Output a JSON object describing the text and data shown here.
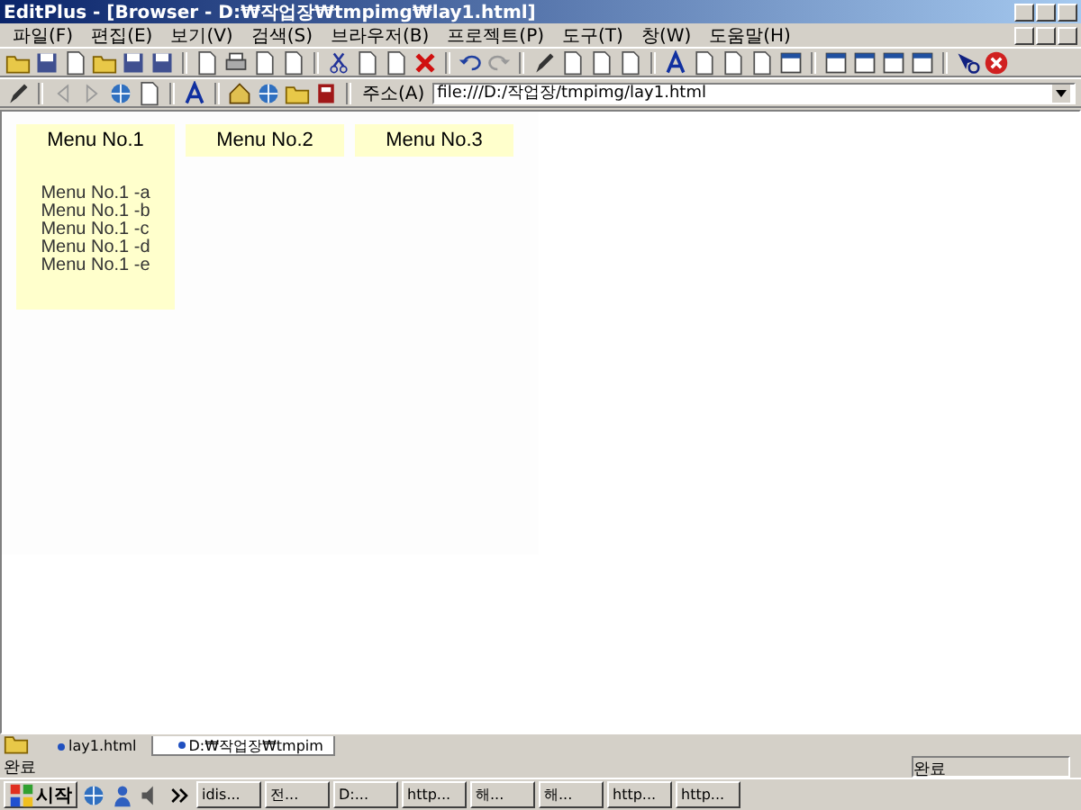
{
  "window": {
    "title": "EditPlus - [Browser - D:₩작업장₩tmpimg₩lay1.html]"
  },
  "menu_bar": [
    "파일(F)",
    "편집(E)",
    "보기(V)",
    "검색(S)",
    "브라우저(B)",
    "프로젝트(P)",
    "도구(T)",
    "창(W)",
    "도움말(H)"
  ],
  "address_bar": {
    "label": "주소(A)",
    "value": "file:///D:/작업장/tmpimg/lay1.html"
  },
  "page": {
    "menus": [
      {
        "title": "Menu No.1",
        "expanded": true,
        "items": [
          "Menu No.1 -a",
          "Menu No.1 -b",
          "Menu No.1 -c",
          "Menu No.1 -d",
          "Menu No.1 -e"
        ]
      },
      {
        "title": "Menu No.2",
        "expanded": false
      },
      {
        "title": "Menu No.3",
        "expanded": false
      }
    ]
  },
  "document_tabs": [
    {
      "label": "lay1.html",
      "selected": false
    },
    {
      "label": "D:₩작업장₩tmpim",
      "selected": true
    }
  ],
  "status_bar": {
    "left": "완료",
    "right": "완료"
  },
  "taskbar": {
    "start": "시작",
    "buttons": [
      "idis...",
      "전...",
      "D:...",
      "http...",
      "해...",
      "해...",
      "http...",
      "http..."
    ]
  }
}
